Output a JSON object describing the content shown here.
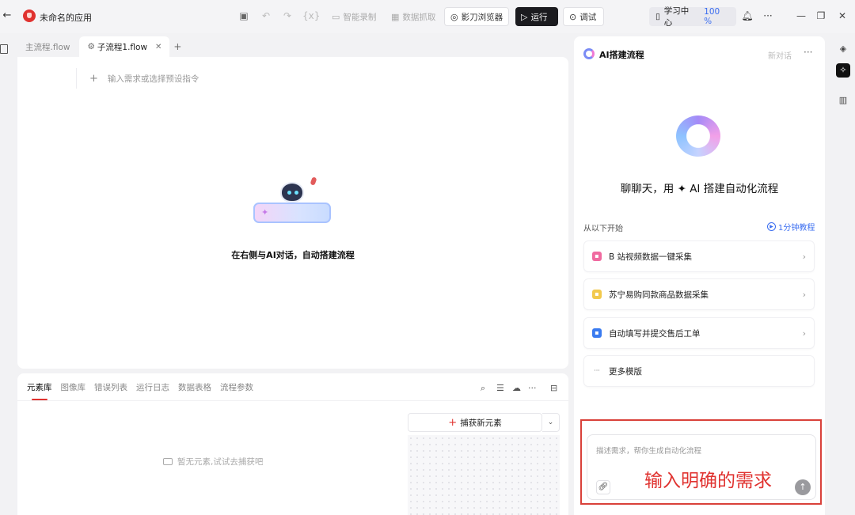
{
  "app": {
    "title": "未命名的应用"
  },
  "toolbar": {
    "smart_record": "智能录制",
    "data_extract": "数据抓取",
    "browser": "影刀浏览器",
    "run": "运行",
    "debug": "调试",
    "learning_center": "学习中心",
    "zoom": "100 %"
  },
  "tabs": [
    {
      "label": "主流程.flow"
    },
    {
      "label": "子流程1.flow"
    }
  ],
  "canvas": {
    "command_placeholder": "输入需求或选择预设指令",
    "hint": "在右侧与AI对话，自动搭建流程"
  },
  "bottom_panel": {
    "tabs": [
      "元素库",
      "图像库",
      "错误列表",
      "运行日志",
      "数据表格",
      "流程参数"
    ],
    "capture_label": "捕获新元素",
    "empty_text": "暂无元素,试试去捕获吧"
  },
  "ai_panel": {
    "title": "AI搭建流程",
    "new_chat": "新对话",
    "headline": "聊聊天，用 ✦ AI 搭建自动化流程",
    "start_label": "从以下开始",
    "tutorial": "1分钟教程",
    "templates": [
      {
        "label": "B 站视频数据一键采集",
        "color": "#f06aa0"
      },
      {
        "label": "苏宁易购同款商品数据采集",
        "color": "#f2c94c"
      },
      {
        "label": "自动填写并提交售后工单",
        "color": "#3a7bf0"
      },
      {
        "label": "更多模版",
        "color": "#999999"
      }
    ],
    "input_placeholder": "描述需求，帮你生成自动化流程",
    "annotation": "输入明确的需求"
  }
}
